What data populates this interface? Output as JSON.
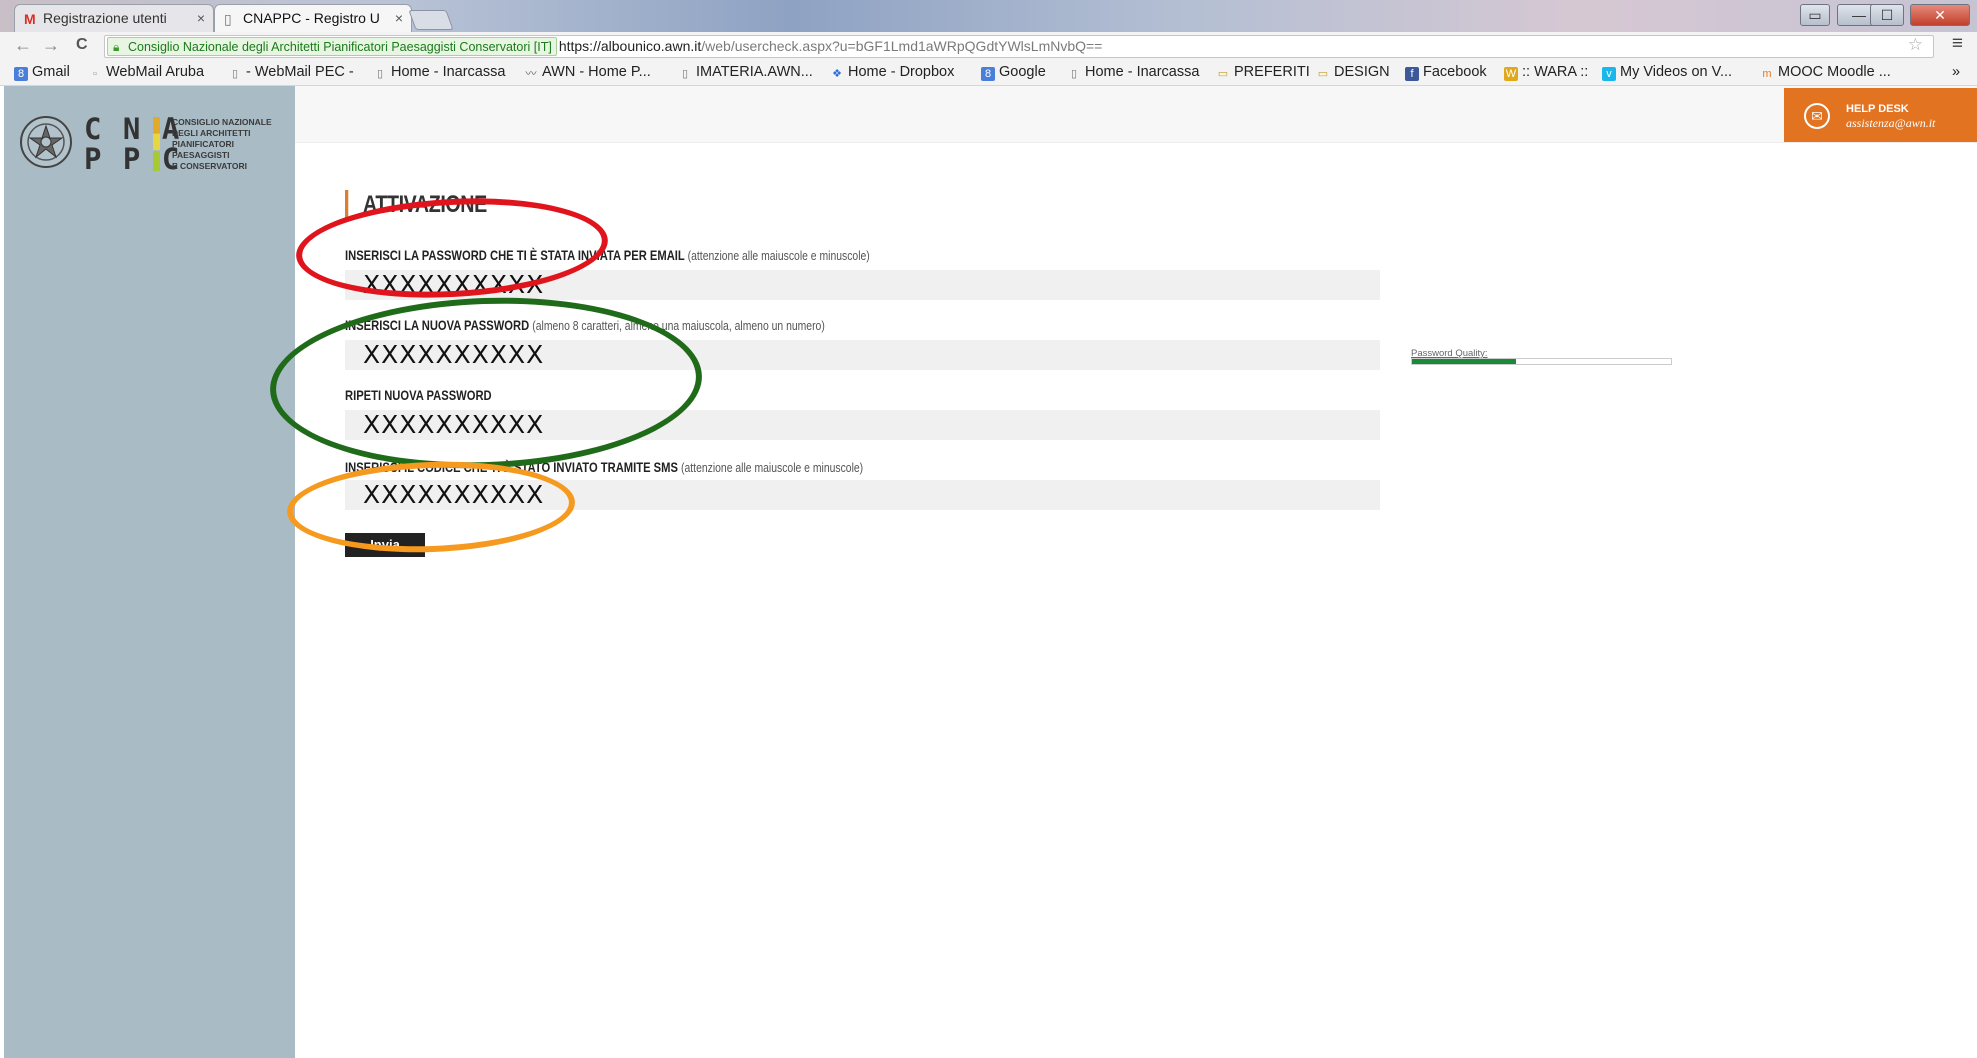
{
  "browser": {
    "tabs": [
      {
        "label": "Registrazione utenti",
        "icon": "gmail-icon",
        "active": false
      },
      {
        "label": "CNAPPC - Registro U",
        "icon": "page-icon",
        "active": true
      }
    ],
    "window_controls": {
      "restore": "▭",
      "minimize": "—",
      "maximize": "☐",
      "close": "✕"
    },
    "nav": {
      "back": "←",
      "forward": "→",
      "reload": "C"
    },
    "security_label": "Consiglio Nazionale degli Architetti Pianificatori Paesaggisti Conservatori [IT]",
    "url_host": "https://albounico.awn.it",
    "url_path": "/web/usercheck.aspx?u=bGF1Lmd1aWRpQGdtYWlsLmNvbQ==",
    "star": "☆",
    "menu": "≡",
    "bookmarks": [
      {
        "label": "Gmail",
        "icon": "google-icon"
      },
      {
        "label": "WebMail Aruba",
        "icon": "page-icon"
      },
      {
        "label": "- WebMail PEC -",
        "icon": "page-icon"
      },
      {
        "label": "Home - Inarcassa",
        "icon": "page-icon"
      },
      {
        "label": "AWN - Home P...",
        "icon": "awn-icon"
      },
      {
        "label": "IMATERIA.AWN...",
        "icon": "page-icon"
      },
      {
        "label": "Home - Dropbox",
        "icon": "dropbox-icon"
      },
      {
        "label": "Google",
        "icon": "google-icon"
      },
      {
        "label": "Home - Inarcassa",
        "icon": "page-icon"
      },
      {
        "label": "PREFERITI",
        "icon": "folder-icon"
      },
      {
        "label": "DESIGN",
        "icon": "folder-icon"
      },
      {
        "label": "Facebook",
        "icon": "facebook-icon"
      },
      {
        "label": ":: WARA ::",
        "icon": "wara-icon"
      },
      {
        "label": "My Videos on V...",
        "icon": "vimeo-icon"
      },
      {
        "label": "MOOC Moodle ...",
        "icon": "moodle-icon"
      }
    ],
    "more": "»"
  },
  "logo": {
    "line1": "C N A",
    "line2": "P P C",
    "subtitle": [
      "CONSIGLIO NAZIONALE",
      "DEGLI ARCHITETTI",
      "PIANIFICATORI",
      "PAESAGGISTI",
      "E CONSERVATORI"
    ]
  },
  "helpdesk": {
    "title": "HELP DESK",
    "email": "assistenza@awn.it",
    "icon": "envelope-icon"
  },
  "form": {
    "title": "ATTIVAZIONE",
    "fields": [
      {
        "label": "INSERISCI LA PASSWORD CHE TI È STATA INVIATA PER EMAIL",
        "hint": "(attenzione alle maiuscole e minuscole)",
        "value": "XXXXXXXXXX"
      },
      {
        "label": "INSERISCI LA NUOVA PASSWORD",
        "hint": "(almeno 8 caratteri, almeno una maiuscola, almeno un numero)",
        "value": "XXXXXXXXXX"
      },
      {
        "label": "RIPETI NUOVA PASSWORD",
        "hint": "",
        "value": "XXXXXXXXXX"
      },
      {
        "label": "INSERISCI IL CODICE CHE TI È STATO INVIATO TRAMITE SMS",
        "hint": "(attenzione alle maiuscole e minuscole)",
        "value": "XXXXXXXXXX"
      }
    ],
    "password_quality_label": "Password Quality:",
    "password_quality": 0.4,
    "submit_label": "Invia"
  },
  "annotations": {
    "colors": [
      "#e0141c",
      "#1f6b1a",
      "#f59a1e"
    ]
  }
}
